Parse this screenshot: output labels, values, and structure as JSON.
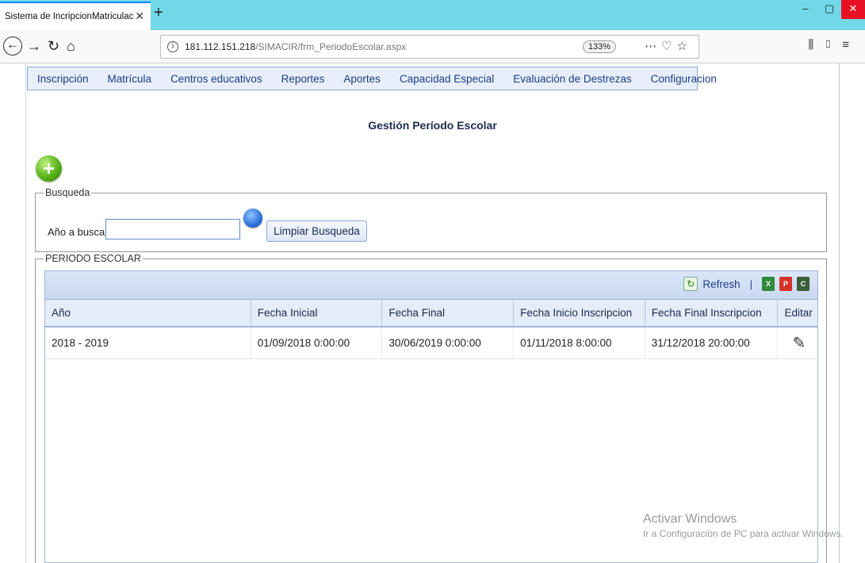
{
  "browser": {
    "tab_title": "Sistema de IncripcionMatriculación",
    "tab_close": "✕",
    "new_tab": "+",
    "url_host": "181.112.151.218",
    "url_path": "/SIMACIR/frm_PeriodoEscolar.aspx",
    "zoom": "133%",
    "window_min": "–",
    "window_max": "▢",
    "window_close": "✕"
  },
  "menu": {
    "items": [
      {
        "label": "Inscripción"
      },
      {
        "label": "Matrícula"
      },
      {
        "label": "Centros educativos"
      },
      {
        "label": "Reportes"
      },
      {
        "label": "Aportes"
      },
      {
        "label": "Capacidad Especial"
      },
      {
        "label": "Evaluación de Destrezas"
      },
      {
        "label": "Configuracion"
      }
    ]
  },
  "page": {
    "title": "Gestión Período Escolar"
  },
  "search": {
    "legend": "Busqueda",
    "label": "Año a buscar",
    "value": "",
    "clear_label": "Limpiar Busqueda"
  },
  "periodo": {
    "legend": "PERIODO ESCOLAR",
    "refresh_label": "Refresh",
    "separator": "|",
    "columns": [
      "Año",
      "Fecha Inicial",
      "Fecha Final",
      "Fecha Inicio Inscripcion",
      "Fecha Final Inscripcion",
      "Editar"
    ],
    "rows": [
      {
        "anio": "2018 - 2019",
        "fecha_inicial": "01/09/2018 0:00:00",
        "fecha_final": "30/06/2019 0:00:00",
        "fecha_inicio_inscripcion": "01/11/2018 8:00:00",
        "fecha_final_inscripcion": "31/12/2018 20:00:00"
      }
    ]
  },
  "watermark": {
    "line1": "Activar Windows",
    "line2": "Ir a Configuración de PC para activar Windows."
  }
}
